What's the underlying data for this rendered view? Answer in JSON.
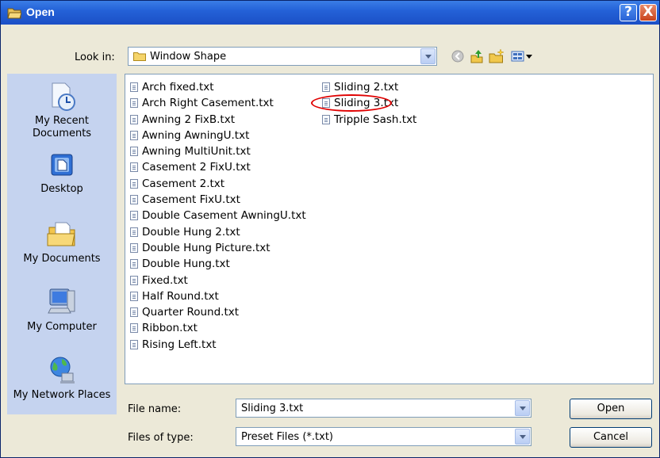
{
  "window": {
    "title": "Open",
    "help_label": "?",
    "close_label": "X"
  },
  "lookin": {
    "label": "Look in:",
    "value": "Window Shape"
  },
  "toolbar": {
    "icons": [
      "back-icon",
      "up-folder-icon",
      "new-folder-icon",
      "views-menu-icon"
    ]
  },
  "places": [
    {
      "label": "My Recent Documents",
      "icon": "recent-documents-icon"
    },
    {
      "label": "Desktop",
      "icon": "desktop-icon"
    },
    {
      "label": "My Documents",
      "icon": "my-documents-icon"
    },
    {
      "label": "My Computer",
      "icon": "my-computer-icon"
    },
    {
      "label": "My Network Places",
      "icon": "network-places-icon"
    }
  ],
  "files": {
    "column1": [
      "Arch fixed.txt",
      "Arch Right Casement.txt",
      "Awning 2 FixB.txt",
      "Awning AwningU.txt",
      "Awning MultiUnit.txt",
      "Casement 2 FixU.txt",
      "Casement 2.txt",
      "Casement FixU.txt",
      "Double Casement AwningU.txt",
      "Double Hung 2.txt",
      "Double Hung Picture.txt",
      "Double Hung.txt",
      "Fixed.txt",
      "Half Round.txt",
      "Quarter Round.txt",
      "Ribbon.txt",
      "Rising Left.txt"
    ],
    "column2": [
      "Sliding 2.txt",
      "Sliding 3.txt",
      "Tripple Sash.txt"
    ],
    "highlighted": "Sliding 3.txt",
    "highlight_color": "#e00000"
  },
  "filename": {
    "label": "File name:",
    "value": "Sliding 3.txt"
  },
  "filetype": {
    "label": "Files of type:",
    "value": "Preset Files (*.txt)"
  },
  "buttons": {
    "open": "Open",
    "cancel": "Cancel"
  },
  "colors": {
    "titlebar": "#2462d8",
    "dialog_bg": "#ece9d8",
    "places_bg": "#c5d3ef"
  }
}
